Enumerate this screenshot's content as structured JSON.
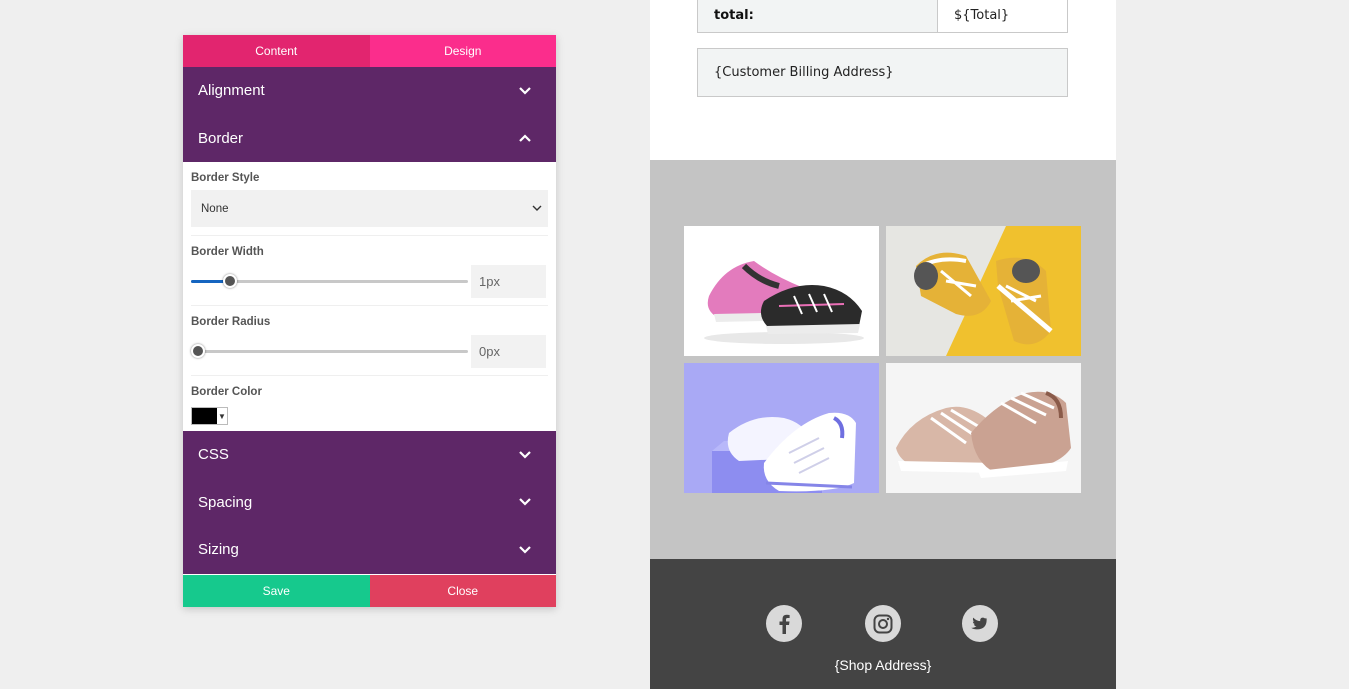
{
  "editor": {
    "tabs": {
      "content": "Content",
      "design": "Design"
    },
    "sections": {
      "alignment": "Alignment",
      "border": "Border",
      "css": "CSS",
      "spacing": "Spacing",
      "sizing": "Sizing"
    },
    "border": {
      "style_label": "Border Style",
      "style_value": "None",
      "width_label": "Border Width",
      "width_value": "1px",
      "width_fraction": 0.12,
      "radius_label": "Border Radius",
      "radius_value": "0px",
      "radius_fraction": 0.0,
      "color_label": "Border Color",
      "color_value": "#000000"
    },
    "footer": {
      "save": "Save",
      "close": "Close"
    }
  },
  "preview": {
    "total_label": "total:",
    "total_value": "${Total}",
    "billing_address": "{Customer Billing Address}",
    "shop_address": "{Shop Address}",
    "social_icons": [
      "facebook-icon",
      "instagram-icon",
      "twitter-icon"
    ]
  },
  "colors": {
    "tab_content": "#e2256f",
    "tab_design": "#fb2d8c",
    "section_header": "#5e2767",
    "save": "#16c98d",
    "close": "#e0405e",
    "slider_fill": "#1565c0"
  }
}
